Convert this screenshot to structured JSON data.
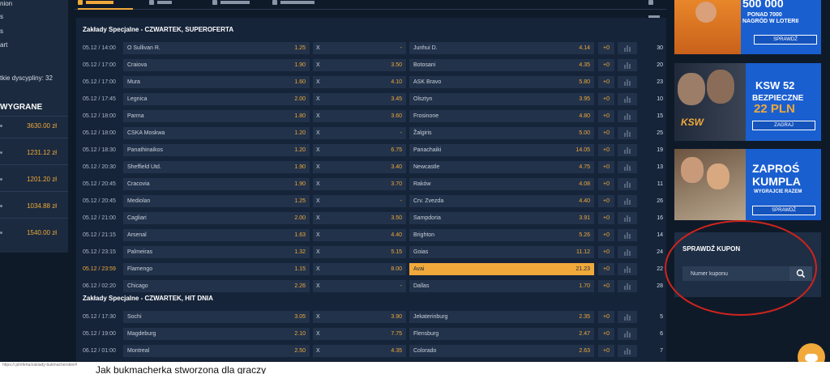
{
  "sidebar": {
    "nav": [
      "nion",
      "s",
      "s",
      "art"
    ],
    "disciplines_text": "tkie dyscypliny: 32",
    "winners_title": "WYGRANE",
    "winnings": [
      "3630.00 zł",
      "1231.12 zł",
      "1201.20 zł",
      "1034.88 zł",
      "1540.00 zł"
    ]
  },
  "sections": [
    {
      "title": "Zakłady Specjalne - CZWARTEK, SUPEROFERTA",
      "rows": [
        {
          "time": "05.12 / 14:00",
          "home": "O Sullivan R.",
          "home_odd": "1.25",
          "draw": "X",
          "draw_odd": "-",
          "away": "Junhui D.",
          "away_odd": "4.14",
          "plus": "+0",
          "count": "30"
        },
        {
          "time": "05.12 / 17:00",
          "home": "Craiova",
          "home_odd": "1.90",
          "draw": "X",
          "draw_odd": "3.50",
          "away": "Botosani",
          "away_odd": "4.35",
          "plus": "+0",
          "count": "20"
        },
        {
          "time": "05.12 / 17:00",
          "home": "Mura",
          "home_odd": "1.60",
          "draw": "X",
          "draw_odd": "4.10",
          "away": "ASK Bravo",
          "away_odd": "5.80",
          "plus": "+0",
          "count": "23"
        },
        {
          "time": "05.12 / 17:45",
          "home": "Legnica",
          "home_odd": "2.00",
          "draw": "X",
          "draw_odd": "3.45",
          "away": "Olsztyn",
          "away_odd": "3.95",
          "plus": "+0",
          "count": "10"
        },
        {
          "time": "05.12 / 18:00",
          "home": "Parma",
          "home_odd": "1.80",
          "draw": "X",
          "draw_odd": "3.60",
          "away": "Frosinone",
          "away_odd": "4.80",
          "plus": "+0",
          "count": "15"
        },
        {
          "time": "05.12 / 18:00",
          "home": "CSKA Moskwa",
          "home_odd": "1.20",
          "draw": "X",
          "draw_odd": "-",
          "away": "Žalgiris",
          "away_odd": "5.00",
          "plus": "+0",
          "count": "25"
        },
        {
          "time": "05.12 / 18:30",
          "home": "Panathinaikos",
          "home_odd": "1.20",
          "draw": "X",
          "draw_odd": "6.75",
          "away": "Panachaiki",
          "away_odd": "14.05",
          "plus": "+0",
          "count": "19"
        },
        {
          "time": "05.12 / 20:30",
          "home": "Sheffield Utd.",
          "home_odd": "1.90",
          "draw": "X",
          "draw_odd": "3.40",
          "away": "Newcastle",
          "away_odd": "4.75",
          "plus": "+0",
          "count": "13"
        },
        {
          "time": "05.12 / 20:45",
          "home": "Cracovia",
          "home_odd": "1.90",
          "draw": "X",
          "draw_odd": "3.70",
          "away": "Raków",
          "away_odd": "4.08",
          "plus": "+0",
          "count": "11"
        },
        {
          "time": "05.12 / 20:45",
          "home": "Mediolan",
          "home_odd": "1.25",
          "draw": "X",
          "draw_odd": "-",
          "away": "Crv. Zvezda",
          "away_odd": "4.40",
          "plus": "+0",
          "count": "26"
        },
        {
          "time": "05.12 / 21:00",
          "home": "Cagliari",
          "home_odd": "2.00",
          "draw": "X",
          "draw_odd": "3.50",
          "away": "Sampdoria",
          "away_odd": "3.91",
          "plus": "+0",
          "count": "16"
        },
        {
          "time": "05.12 / 21:15",
          "home": "Arsenal",
          "home_odd": "1.63",
          "draw": "X",
          "draw_odd": "4.40",
          "away": "Brighton",
          "away_odd": "5.26",
          "plus": "+0",
          "count": "14"
        },
        {
          "time": "05.12 / 23:15",
          "home": "Palmeiras",
          "home_odd": "1.32",
          "draw": "X",
          "draw_odd": "5.15",
          "away": "Goias",
          "away_odd": "11.12",
          "plus": "+0",
          "count": "24"
        },
        {
          "time": "05.12 / 23:59",
          "home": "Flamengo",
          "home_odd": "1.15",
          "draw": "X",
          "draw_odd": "8.00",
          "away": "Avai",
          "away_odd": "21.23",
          "plus": "+0",
          "count": "22"
        },
        {
          "time": "06.12 / 02:20",
          "home": "Chicago",
          "home_odd": "2.26",
          "draw": "X",
          "draw_odd": "-",
          "away": "Dallas",
          "away_odd": "1.70",
          "plus": "+0",
          "count": "28"
        }
      ]
    },
    {
      "title": "Zakłady Specjalne - CZWARTEK, HIT DNIA",
      "rows": [
        {
          "time": "05.12 / 17:30",
          "home": "Sochi",
          "home_odd": "3.05",
          "draw": "X",
          "draw_odd": "3.90",
          "away": "Jekaterinburg",
          "away_odd": "2.35",
          "plus": "+0",
          "count": "5"
        },
        {
          "time": "05.12 / 19:00",
          "home": "Magdeburg",
          "home_odd": "2.10",
          "draw": "X",
          "draw_odd": "7.75",
          "away": "Flensburg",
          "away_odd": "2.47",
          "plus": "+0",
          "count": "6"
        },
        {
          "time": "06.12 / 01:00",
          "home": "Montreal",
          "home_odd": "2.50",
          "draw": "X",
          "draw_odd": "4.35",
          "away": "Colorado",
          "away_odd": "2.63",
          "plus": "+0",
          "count": "7"
        }
      ]
    }
  ],
  "ads": {
    "lottery": {
      "amount": "500 000",
      "line1": "PONAD 7000",
      "line2": "NAGRÓD W LOTERII",
      "button": "SPRAWDŹ"
    },
    "ksw": {
      "brand": "KSW",
      "line1": "KSW 52",
      "line2": "BEZPIECZNE",
      "line3": "22 PLN",
      "button": "ZAGRAJ"
    },
    "invite": {
      "line1": "ZAPROŚ",
      "line2": "KUMPLA",
      "line3": "WYGRAJCIE RAZEM",
      "button": "SPRAWDŹ"
    }
  },
  "coupon": {
    "title": "SPRAWDŹ KUPON",
    "placeholder": "Numer kuponu"
  },
  "footer": {
    "url": "https://.pl/oferta/zaklady-bukmacherskie/#",
    "heading": "Jak bukmacherka stworzona dla graczy"
  },
  "colors": {
    "accent": "#f0a93a",
    "panel": "#16243a",
    "cell": "#22324a",
    "annotation": "#d0241c"
  }
}
